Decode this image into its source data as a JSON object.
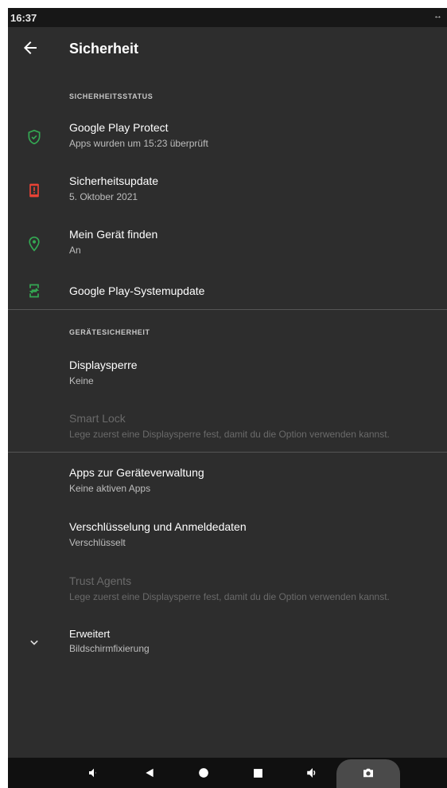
{
  "status_bar": {
    "time": "16:37",
    "rotate_icon": "rotate-icon"
  },
  "app_bar": {
    "title": "Sicherheit",
    "back_icon": "back-arrow-icon"
  },
  "sections": {
    "status_header": "SICHERHEITSSTATUS",
    "device_header": "GERÄTESICHERHEIT"
  },
  "items": {
    "play_protect": {
      "title": "Google Play Protect",
      "subtitle": "Apps wurden um 15:23 überprüft",
      "icon": "shield-check-icon",
      "icon_color": "#34a853"
    },
    "security_update": {
      "title": "Sicherheitsupdate",
      "subtitle": "5. Oktober 2021",
      "icon": "phone-alert-icon",
      "icon_color": "#ea4335"
    },
    "find_device": {
      "title": "Mein Gerät finden",
      "subtitle": "An",
      "icon": "location-pin-icon",
      "icon_color": "#34a853"
    },
    "play_system_update": {
      "title": "Google Play-Systemupdate",
      "icon": "phone-sync-icon",
      "icon_color": "#34a853"
    },
    "screen_lock": {
      "title": "Displaysperre",
      "subtitle": "Keine"
    },
    "smart_lock": {
      "title": "Smart Lock",
      "subtitle": "Lege zuerst eine Displaysperre fest, damit du die Option verwenden kannst."
    },
    "device_admin": {
      "title": "Apps zur Geräteverwaltung",
      "subtitle": "Keine aktiven Apps"
    },
    "encryption": {
      "title": "Verschlüsselung und Anmeldedaten",
      "subtitle": "Verschlüsselt"
    },
    "trust_agents": {
      "title": "Trust Agents",
      "subtitle": "Lege zuerst eine Displaysperre fest, damit du die Option verwenden kannst."
    },
    "advanced": {
      "title": "Erweitert",
      "subtitle": "Bildschirmfixierung",
      "icon": "chevron-down-icon"
    }
  },
  "nav_bar": {
    "icons": [
      "volume-down-icon",
      "back-triangle-icon",
      "home-circle-icon",
      "recents-square-icon",
      "volume-up-icon",
      "camera-icon"
    ]
  }
}
